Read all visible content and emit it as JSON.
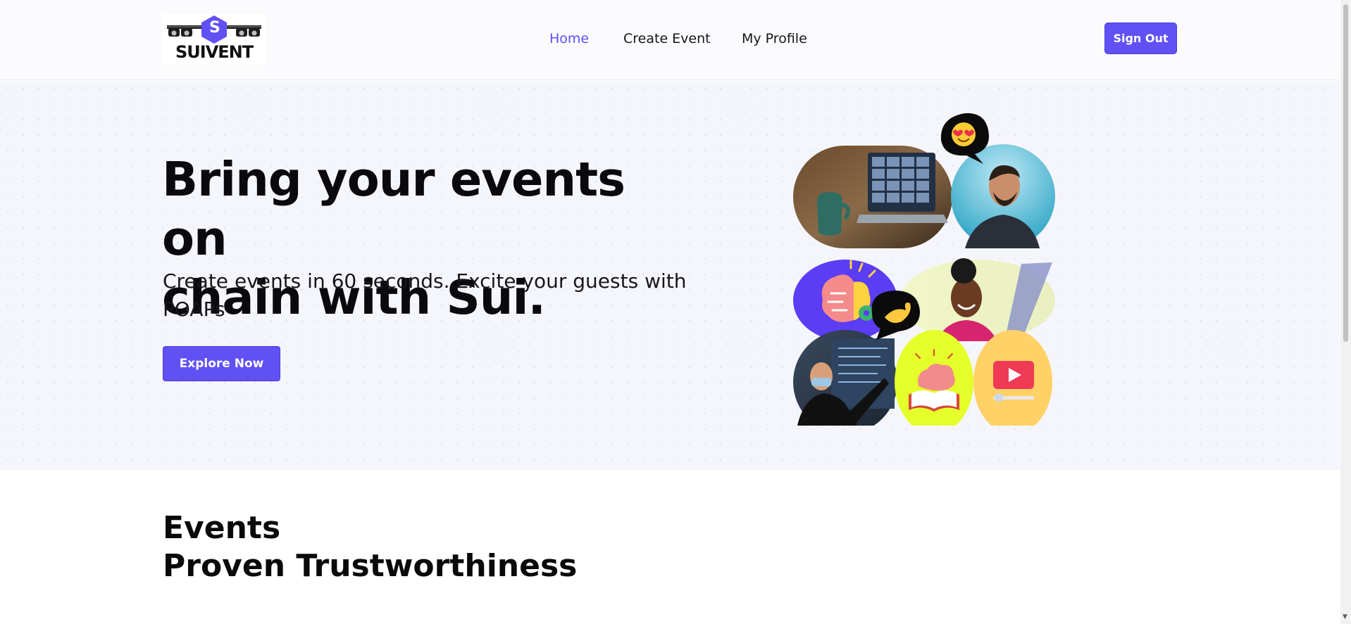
{
  "header": {
    "logo_text": "SUIVENT",
    "logo_badge": "S",
    "nav": [
      {
        "label": "Home",
        "active": true
      },
      {
        "label": "Create Event",
        "active": false
      },
      {
        "label": "My Profile",
        "active": false
      }
    ],
    "sign_out_label": "Sign Out"
  },
  "hero": {
    "title_line1": "Bring your events on",
    "title_line2": "chain with Sui.",
    "subtitle": "Create events in 60 seconds. Excite your guests with POAPs",
    "cta_label": "Explore Now",
    "collage_icons": [
      "laptop-meeting-photo",
      "smiling-man-photo",
      "brain-idea-icon",
      "smiling-woman-photo",
      "presenter-photo",
      "brain-book-icon",
      "video-play-icon",
      "heart-eyes-emoji",
      "wave-hand-emoji"
    ]
  },
  "section": {
    "title": "Events",
    "subtitle": "Proven Trustworthiness"
  },
  "colors": {
    "accent": "#6150f3",
    "hero_bg": "#f5f6fb",
    "lime": "#e5ff2a",
    "yellow": "#ffd166"
  }
}
